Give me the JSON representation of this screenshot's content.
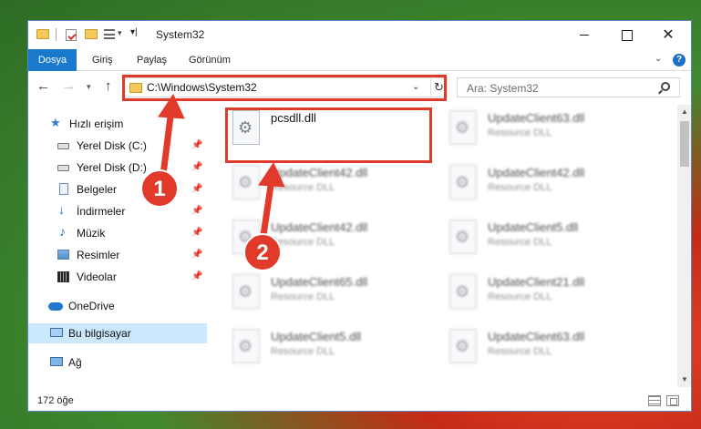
{
  "window": {
    "title": "System32",
    "controls": {
      "minimize": "",
      "maximize": "",
      "close": "✕"
    }
  },
  "quick_access_toolbar": {
    "customize_glyph": "▾|"
  },
  "ribbon": {
    "tabs": [
      {
        "label": "Dosya",
        "active": true
      },
      {
        "label": "Giriş"
      },
      {
        "label": "Paylaş"
      },
      {
        "label": "Görünüm"
      }
    ],
    "help": "?"
  },
  "navigation": {
    "back": "←",
    "forward": "→",
    "recent": "▾",
    "up": "↑",
    "address": "C:\\Windows\\System32",
    "address_dropdown": "⌄",
    "refresh": "↻",
    "search_placeholder": "Ara: System32"
  },
  "sidebar": {
    "items": [
      {
        "label": "Hızlı erişim",
        "icon": "star-icon"
      },
      {
        "label": "Yerel Disk (C:)",
        "icon": "drive-icon",
        "pinned": true
      },
      {
        "label": "Yerel Disk (D:)",
        "icon": "drive-icon",
        "pinned": true
      },
      {
        "label": "Belgeler",
        "icon": "documents-icon",
        "pinned": true
      },
      {
        "label": "İndirmeler",
        "icon": "download-icon",
        "pinned": true
      },
      {
        "label": "Müzik",
        "icon": "music-icon",
        "pinned": true
      },
      {
        "label": "Resimler",
        "icon": "pictures-icon",
        "pinned": true
      },
      {
        "label": "Videolar",
        "icon": "video-icon",
        "pinned": true
      },
      {
        "label": "OneDrive",
        "icon": "cloud-icon"
      },
      {
        "label": "Bu bilgisayar",
        "icon": "computer-icon",
        "selected": true
      },
      {
        "label": "Ağ",
        "icon": "network-icon"
      }
    ]
  },
  "files": [
    {
      "name": "pcsdll.dll",
      "type": ""
    },
    {
      "name": "UpdateClient63.dll",
      "type": "Resource DLL"
    },
    {
      "name": "UpdateClient42.dll",
      "type": "Resource DLL"
    },
    {
      "name": "UpdateClient42.dll",
      "type": "Resource DLL"
    },
    {
      "name": "UpdateClient42.dll",
      "type": "Resource DLL"
    },
    {
      "name": "UpdateClient5.dll",
      "type": "Resource DLL"
    },
    {
      "name": "UpdateClient65.dll",
      "type": "Resource DLL"
    },
    {
      "name": "UpdateClient21.dll",
      "type": "Resource DLL"
    },
    {
      "name": "UpdateClient5.dll",
      "type": "Resource DLL"
    },
    {
      "name": "UpdateClient63.dll",
      "type": "Resource DLL"
    }
  ],
  "status": {
    "item_count": "172 öğe"
  },
  "callouts": [
    {
      "number": "1"
    },
    {
      "number": "2"
    }
  ],
  "colors": {
    "accent": "#1979ca",
    "annotation": "#e23a2a",
    "selected": "#cce8ff"
  }
}
